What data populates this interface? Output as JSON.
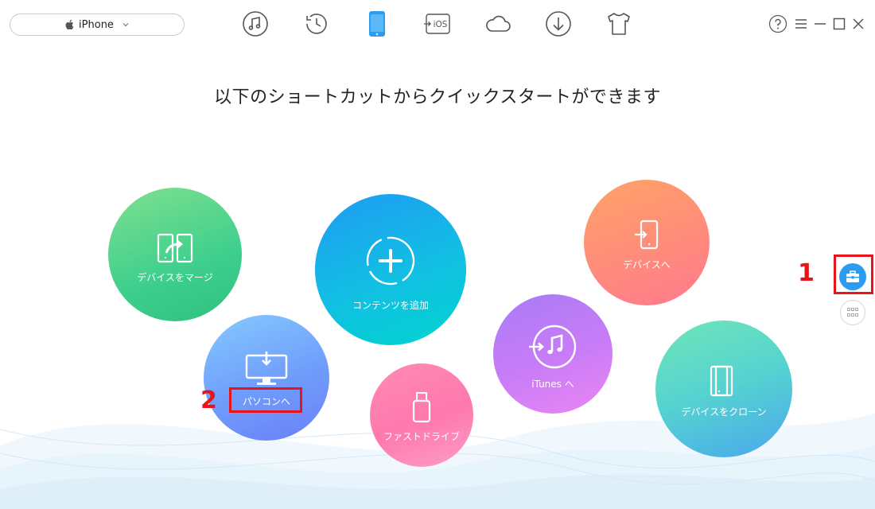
{
  "device_selector": {
    "label": "iPhone",
    "icon": "apple-icon"
  },
  "nav": [
    {
      "name": "music-icon"
    },
    {
      "name": "history-icon"
    },
    {
      "name": "device-icon",
      "active": true
    },
    {
      "name": "to-ios-icon",
      "text": "iOS"
    },
    {
      "name": "icloud-icon"
    },
    {
      "name": "download-icon"
    },
    {
      "name": "shirt-icon"
    }
  ],
  "window_controls": [
    "help-icon",
    "menu-icon",
    "minimize-icon",
    "maximize-icon",
    "close-icon"
  ],
  "headline": "以下のショートカットからクイックスタートができます",
  "shortcuts": {
    "merge": {
      "label": "デバイスをマージ",
      "color_from": "#7fe08e",
      "color_to": "#2fc07e"
    },
    "add": {
      "label": "コンテンツを追加",
      "color_from": "#1e9bf3",
      "color_to": "#00d4cf"
    },
    "to_device": {
      "label": "デバイスへ",
      "color_from": "#ffa267",
      "color_to": "#ff7a8f"
    },
    "to_pc": {
      "label": "パソコンへ",
      "color_from": "#85c9ff",
      "color_to": "#6b7ff8"
    },
    "to_itunes": {
      "label": "iTunes へ",
      "color_from": "#a97bf5",
      "color_to": "#ec86f4"
    },
    "flash_drive": {
      "label": "ファストドライブ",
      "color_from": "#ff8ab4",
      "color_to": "#fc9dc9"
    },
    "clone": {
      "label": "デバイスをクローン",
      "color_from": "#6fe6b8",
      "color_to": "#4aa7ec"
    }
  },
  "side_buttons": [
    "toolbox-icon",
    "grid-icon"
  ],
  "annotations": {
    "one": "1",
    "two": "2",
    "color": "#e8141b"
  },
  "accent": "#2b9cf0"
}
